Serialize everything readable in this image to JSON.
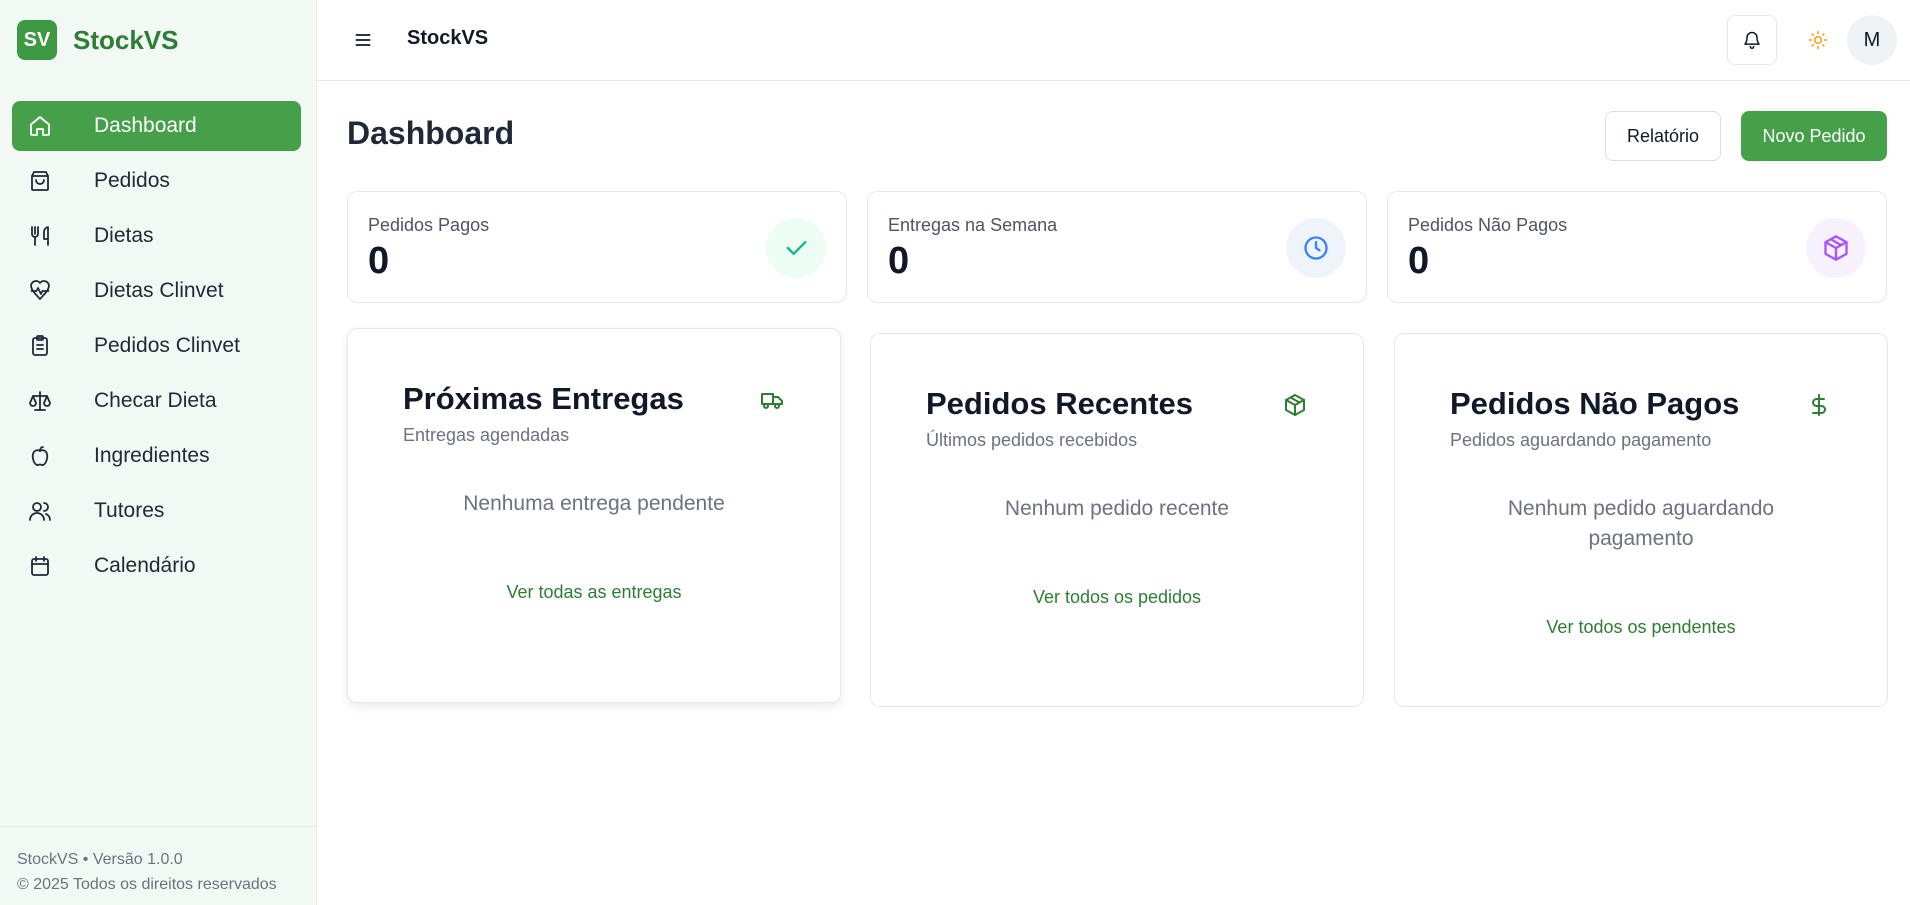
{
  "brand": {
    "logo_text": "SV",
    "name": "StockVS",
    "accent": "#45a049"
  },
  "sidebar": {
    "items": [
      {
        "label": "Dashboard",
        "icon": "home-icon",
        "active": true
      },
      {
        "label": "Pedidos",
        "icon": "shopping-bag-icon"
      },
      {
        "label": "Dietas",
        "icon": "utensils-icon"
      },
      {
        "label": "Dietas Clinvet",
        "icon": "heart-pulse-icon"
      },
      {
        "label": "Pedidos Clinvet",
        "icon": "clipboard-list-icon"
      },
      {
        "label": "Checar Dieta",
        "icon": "scale-icon"
      },
      {
        "label": "Ingredientes",
        "icon": "apple-icon"
      },
      {
        "label": "Tutores",
        "icon": "users-icon"
      },
      {
        "label": "Calendário",
        "icon": "calendar-icon"
      }
    ],
    "footer": {
      "version": "StockVS • Versão 1.0.0",
      "copyright": "© 2025 Todos os direitos reservados"
    }
  },
  "topbar": {
    "title": "StockVS",
    "avatar_initial": "M"
  },
  "main": {
    "page_title": "Dashboard",
    "report_button": "Relatório",
    "new_order_button": "Novo Pedido",
    "stats": [
      {
        "label": "Pedidos Pagos",
        "value": "0",
        "icon": "check-icon",
        "color": "#10b981",
        "bg": "#ecfdf5"
      },
      {
        "label": "Entregas na Semana",
        "value": "0",
        "icon": "clock-icon",
        "color": "#3b82f6",
        "bg": "#eff4fb"
      },
      {
        "label": "Pedidos Não Pagos",
        "value": "0",
        "icon": "package-icon",
        "color": "#a855f7",
        "bg": "#f7f1fd"
      }
    ],
    "cards": [
      {
        "title": "Próximas Entregas",
        "subtitle": "Entregas agendadas",
        "icon": "truck-icon",
        "empty": "Nenhuma entrega pendente",
        "link": "Ver todas as entregas"
      },
      {
        "title": "Pedidos Recentes",
        "subtitle": "Últimos pedidos recebidos",
        "icon": "package-icon",
        "empty": "Nenhum pedido recente",
        "link": "Ver todos os pedidos"
      },
      {
        "title": "Pedidos Não Pagos",
        "subtitle": "Pedidos aguardando pagamento",
        "icon": "dollar-icon",
        "empty": "Nenhum pedido aguardando pagamento",
        "link": "Ver todos os pendentes"
      }
    ]
  }
}
